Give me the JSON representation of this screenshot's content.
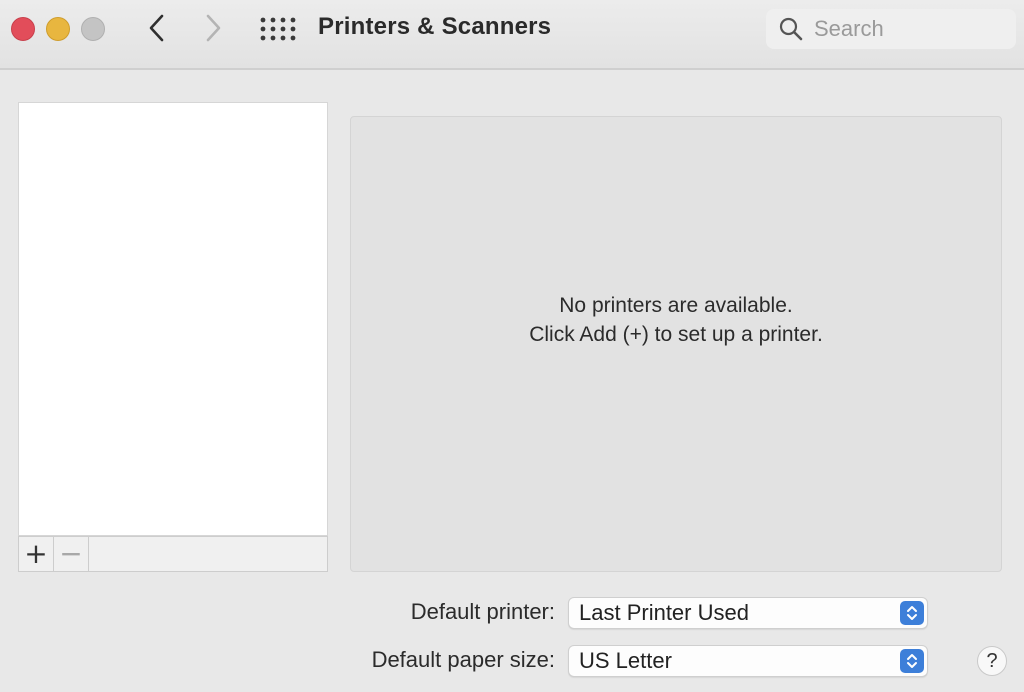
{
  "window": {
    "title": "Printers & Scanners"
  },
  "search": {
    "placeholder": "Search",
    "value": ""
  },
  "icons": {
    "back": "chevron-left-icon",
    "forward": "chevron-right-icon",
    "show_all": "grid-icon",
    "search": "search-icon",
    "add": "+",
    "remove": "−",
    "help": "?"
  },
  "printer_list": {
    "items": []
  },
  "detail": {
    "empty_line1": "No printers are available.",
    "empty_line2": "Click Add (+) to set up a printer."
  },
  "settings": {
    "default_printer_label": "Default printer:",
    "default_printer_value": "Last Printer Used",
    "default_paper_label": "Default paper size:",
    "default_paper_value": "US Letter"
  },
  "colors": {
    "close": "#e24d5a",
    "minimize": "#e8b63f",
    "zoom": "#c4c4c4",
    "accent": "#3d7fd9"
  }
}
